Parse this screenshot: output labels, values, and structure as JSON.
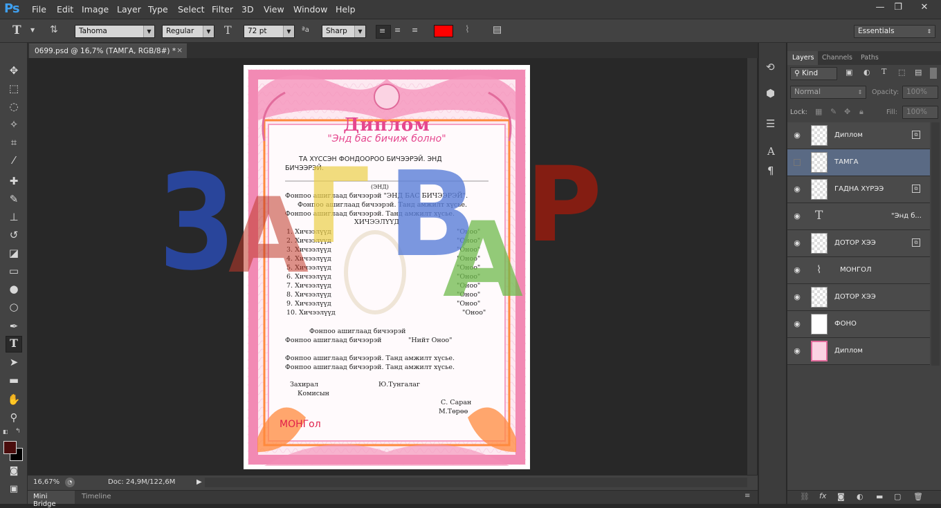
{
  "app": {
    "logo": "Ps"
  },
  "menu": [
    "File",
    "Edit",
    "Image",
    "Layer",
    "Type",
    "Select",
    "Filter",
    "3D",
    "View",
    "Window",
    "Help"
  ],
  "window_controls": {
    "minimize": "—",
    "restore": "❐",
    "close": "✕"
  },
  "options": {
    "tool_icon": "T",
    "font_family": "Tahoma",
    "font_style": "Regular",
    "font_size": "72 pt",
    "aa_label": "ªa",
    "antialias": "Sharp",
    "text_color": "#ff0000",
    "workspace": "Essentials"
  },
  "document_tab": {
    "title": "0699.psd @ 16,7% (ТАМГА, RGB/8#) *",
    "close": "×"
  },
  "status": {
    "zoom": "16,67%",
    "doc": "Doc: 24,9M/122,6M"
  },
  "bottom_tabs": [
    "Mini Bridge",
    "Timeline"
  ],
  "panel": {
    "tabs": [
      "Layers",
      "Channels",
      "Paths"
    ],
    "filter_kind": "Kind",
    "blend_mode": "Normal",
    "opacity_label": "Opacity:",
    "opacity": "100%",
    "lock_label": "Lock:",
    "fill_label": "Fill:",
    "fill": "100%",
    "layers": [
      {
        "name": "Диплом",
        "visible": true,
        "type": "smart"
      },
      {
        "name": "ТАМГА",
        "visible": false,
        "type": "pixel",
        "selected": true
      },
      {
        "name": "ГАДНА ХҮРЭЭ",
        "visible": true,
        "type": "smart"
      },
      {
        "name": "\"Энд б...",
        "visible": true,
        "type": "text"
      },
      {
        "name": "ДОТОР ХЭЭ",
        "visible": true,
        "type": "smart"
      },
      {
        "name": "МОНГОЛ",
        "visible": true,
        "type": "shape"
      },
      {
        "name": "ДОТОР ХЭЭ",
        "visible": true,
        "type": "pixel"
      },
      {
        "name": "ФОНО",
        "visible": true,
        "type": "white"
      },
      {
        "name": "Диплом",
        "visible": true,
        "type": "image"
      }
    ]
  },
  "diploma": {
    "title": "Диплом",
    "subtitle": "\"Энд бас бичиж болно\"",
    "intro1": "ТА ХҮССЭН ФОНДООРОО БИЧЭЭРЭЙ. ЭНД",
    "intro2": "БИЧЭЭРЭЙ.",
    "end_label": "(ЭНД)",
    "l1": "Фонпоо ашиглаад бичээрэй \"ЭНД БАС БИЧЭЭРЭЙ\".",
    "l2": "Фонпоо ашиглаад бичээрэй. Танд амжилт хүсье.",
    "l3": "Фонпоо ашиглаад бичээрэй. Танд амжилт хүсье.",
    "subjects_title": "ХИЧЭЭЛҮҮД",
    "subjects": [
      "1. Хичээлүүд",
      "2. Хичээлүүд",
      "3. Хичээлүүд",
      "4. Хичээлүүд",
      "5. Хичээлүүд",
      "6. Хичээлүүд",
      "7. Хичээлүүд",
      "8. Хичээлүүд",
      "9. Хичээлүүд",
      "10. Хичээлүүд"
    ],
    "grade": "\"Оноо\"",
    "l4": "Фонпоо ашиглаад бичээрэй",
    "l5": "Фонпоо ашиглаад бичээрэй",
    "total": "\"Нийт Оноо\"",
    "l6": "Фонпоо ашиглаад бичээрэй. Танд амжилт хүсье.",
    "l7": "Фонпоо ашиглаад бичээрэй. Танд амжилт хүсье.",
    "director": "Захирал",
    "commission": "Комисын",
    "sig1": "Ю.Тунгалаг",
    "sig2": "С. Саран",
    "sig3": "М.Төрөө",
    "mongol": "МОНГол",
    "watermark": [
      "З",
      "А",
      "Г",
      "В",
      "А",
      "Р"
    ]
  }
}
